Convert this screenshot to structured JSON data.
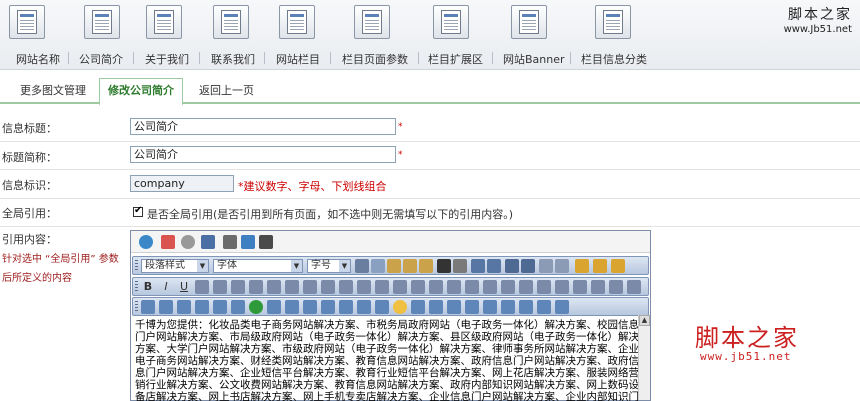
{
  "brand": {
    "logo_text": "脚本之家",
    "logo_url": "www.Jb51.net"
  },
  "top_nav": [
    {
      "label": "网站名称"
    },
    {
      "label": "公司简介"
    },
    {
      "label": "关于我们"
    },
    {
      "label": "联系我们"
    },
    {
      "label": "网站栏目"
    },
    {
      "label": "栏目页面参数"
    },
    {
      "label": "栏目扩展区"
    },
    {
      "label": "网站Banner"
    },
    {
      "label": "栏目信息分类"
    }
  ],
  "tabs": [
    {
      "label": "更多图文管理"
    },
    {
      "label": "修改公司简介",
      "active": true
    },
    {
      "label": "返回上一页"
    }
  ],
  "form": {
    "title_label": "信息标题：",
    "title_value": "公司简介",
    "short_label": "标题简称：",
    "short_value": "公司简介",
    "ident_label": "信息标识：",
    "ident_value": "company",
    "ident_hint": "*建议数字、字母、下划线组合",
    "global_label": "全局引用：",
    "global_text": "是否全局引用(是否引用到所有页面，如不选中则无需填写以下的引用内容。)",
    "global_checked": true,
    "ref_label": "引用内容：",
    "ref_hint_1": "针对选中 “全局引用” 参数",
    "ref_hint_2": "后所定义的内容",
    "required_mark": "*"
  },
  "editor": {
    "paragraph_style": "段落样式",
    "font": "字体",
    "font_size": "字号",
    "content": "千博为您提供：化妆品类电子商务网站解决方案、市税务局政府网站（电子政务一体化）解决方案、校园信息门户网站解决方案、市局级政府网站（电子政务一体化）解决方案、县区级政府网站（电子政务一体化）解决方案、大学门户网站解决方案、市级政府网站（电子政务一体化）解决方案、律师事务所网站解决方案、企业电子商务网站解决方案、财经类网站解决方案、教育信息网站解决方案、政府信息门户网站解决方案、政府信息门户网站解决方案、企业短信平台解决方案、教育行业短信平台解决方案、网上花店解决方案、服装网络营销行业解决方案、公文收费网站解决方案、教育信息网站解决方案、政府内部知识网站解决方案、网上数码设备店解决方案、网上书店解决方案、网上手机专卖店解决方案、企业信息门户网站解决方案、企业内部知识门户网站解决方案……"
  },
  "watermark": {
    "text": "脚本之家",
    "url": "www.jb51.net"
  },
  "colors": {
    "tab_active": "#2c7a2c",
    "tab_border": "#9fc9a0",
    "hint_red": "#cc0000",
    "toolbar_blue": "#b7c7de"
  }
}
